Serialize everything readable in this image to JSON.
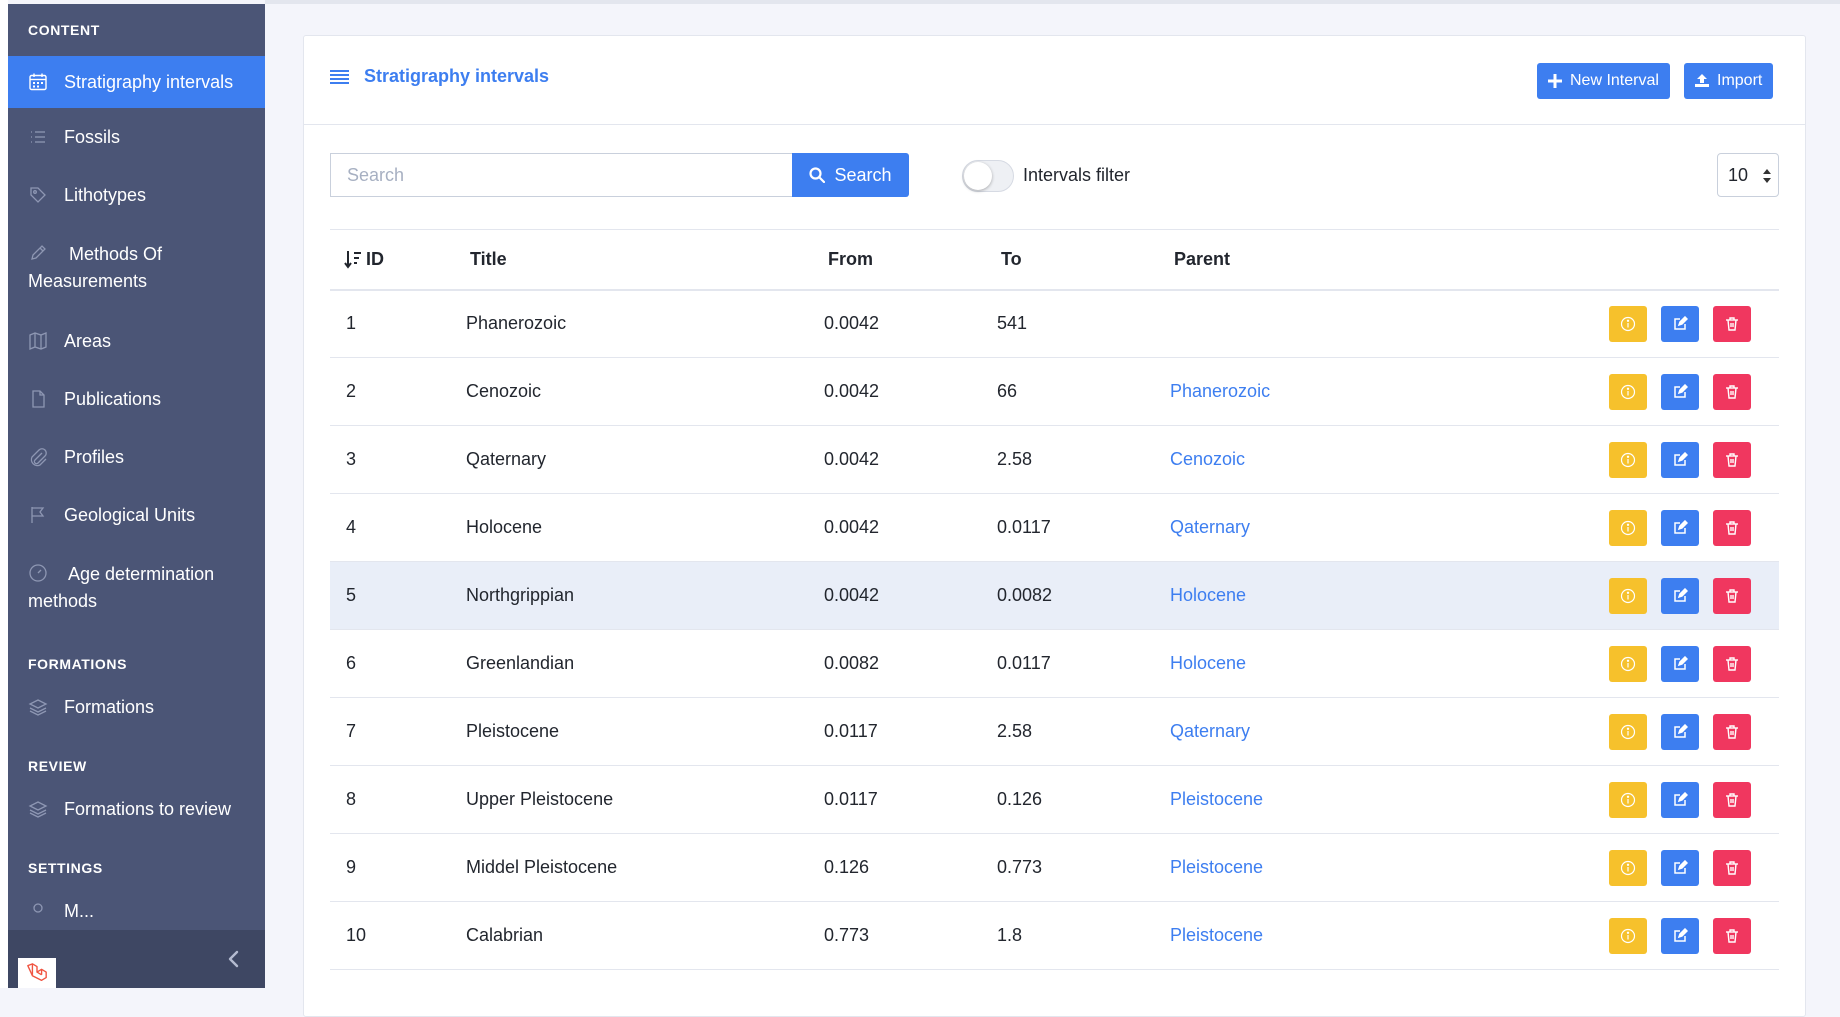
{
  "sidebar": {
    "sections": [
      "CONTENT",
      "FORMATIONS",
      "REVIEW",
      "SETTINGS"
    ],
    "content_items": [
      {
        "label": "Stratigraphy intervals",
        "icon": "calendar-icon"
      },
      {
        "label": "Fossils",
        "icon": "list-icon"
      },
      {
        "label": "Lithotypes",
        "icon": "tag-icon"
      },
      {
        "label": "Methods Of Measurements",
        "icon": "pencil-icon"
      },
      {
        "label": "Areas",
        "icon": "map-icon"
      },
      {
        "label": "Publications",
        "icon": "file-icon"
      },
      {
        "label": "Profiles",
        "icon": "paperclip-icon"
      },
      {
        "label": "Geological Units",
        "icon": "flag-icon"
      },
      {
        "label": "Age determination methods",
        "icon": "gauge-icon"
      }
    ],
    "formations_items": [
      {
        "label": "Formations",
        "icon": "layers-icon"
      }
    ],
    "review_items": [
      {
        "label": "Formations to review",
        "icon": "layers-icon"
      }
    ],
    "settings_partial": "M..."
  },
  "card": {
    "title": "Stratigraphy intervals",
    "new_button": "New Interval",
    "import_button": "Import"
  },
  "toolbar": {
    "search_placeholder": "Search",
    "search_button": "Search",
    "toggle_label": "Intervals filter",
    "toggle_on": false,
    "per_page": "10"
  },
  "table": {
    "headers": [
      "ID",
      "Title",
      "From",
      "To",
      "Parent"
    ],
    "rows": [
      {
        "id": "1",
        "title": "Phanerozoic",
        "from": "0.0042",
        "to": "541",
        "parent": ""
      },
      {
        "id": "2",
        "title": "Cenozoic",
        "from": "0.0042",
        "to": "66",
        "parent": "Phanerozoic"
      },
      {
        "id": "3",
        "title": "Qaternary",
        "from": "0.0042",
        "to": "2.58",
        "parent": "Cenozoic"
      },
      {
        "id": "4",
        "title": "Holocene",
        "from": "0.0042",
        "to": "0.0117",
        "parent": "Qaternary"
      },
      {
        "id": "5",
        "title": "Northgrippian",
        "from": "0.0042",
        "to": "0.0082",
        "parent": "Holocene",
        "highlighted": true
      },
      {
        "id": "6",
        "title": "Greenlandian",
        "from": "0.0082",
        "to": "0.0117",
        "parent": "Holocene"
      },
      {
        "id": "7",
        "title": "Pleistocene",
        "from": "0.0117",
        "to": "2.58",
        "parent": "Qaternary"
      },
      {
        "id": "8",
        "title": "Upper Pleistocene",
        "from": "0.0117",
        "to": "0.126",
        "parent": "Pleistocene"
      },
      {
        "id": "9",
        "title": "Middel Pleistocene",
        "from": "0.126",
        "to": "0.773",
        "parent": "Pleistocene"
      },
      {
        "id": "10",
        "title": "Calabrian",
        "from": "0.773",
        "to": "1.8",
        "parent": "Pleistocene"
      }
    ]
  },
  "colors": {
    "primary": "#3d7ef0",
    "warning": "#f6c12c",
    "danger": "#f0375f",
    "sidebar": "#4b5576"
  }
}
